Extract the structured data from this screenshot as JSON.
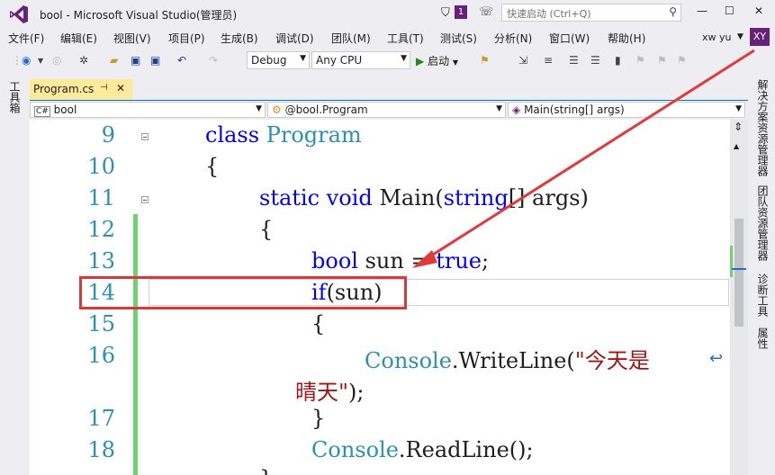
{
  "window": {
    "title": "bool - Microsoft Visual Studio(管理员)",
    "notification_count": "1",
    "quick_launch_placeholder": "快速启动 (Ctrl+Q)",
    "user_name": "xw yu",
    "user_initials": "XY"
  },
  "menu": [
    "文件(F)",
    "编辑(E)",
    "视图(V)",
    "项目(P)",
    "生成(B)",
    "调试(D)",
    "团队(M)",
    "工具(T)",
    "测试(S)",
    "分析(N)",
    "窗口(W)",
    "帮助(H)"
  ],
  "toolbar": {
    "config": "Debug",
    "platform": "Any CPU",
    "start_label": "启动"
  },
  "side_panels": {
    "left": "工具箱",
    "right": [
      "解决方案资源管理器",
      "团队资源管理器",
      "诊断工具",
      "属性"
    ]
  },
  "document_tab": {
    "label": "Program.cs",
    "pin": "⊣",
    "close": "✕"
  },
  "nav": {
    "project": "bool",
    "class": "@bool.Program",
    "member": "Main(string[] args)"
  },
  "code": {
    "line_numbers": [
      "9",
      "10",
      "11",
      "12",
      "13",
      "14",
      "15",
      "16",
      "17",
      "18"
    ],
    "l9_kw": "class",
    "l9_type": "Program",
    "l10": "{",
    "l11_static": "static",
    "l11_void": "void",
    "l11_main": "Main(",
    "l11_string": "string",
    "l11_rest": "[] args)",
    "l12": "{",
    "l13_bool": "bool",
    "l13_rest": "sun = ",
    "l13_true": "true",
    "l13_semi": ";",
    "l14_if": "if",
    "l14_rest": "(sun)",
    "l15": "{",
    "l16_console": "Console",
    "l16_rest": ".WriteLine(",
    "l16_str1": "\"今天是",
    "l16_str2": "晴天\"",
    "l16_end": ");",
    "l17": "}",
    "l18_console": "Console",
    "l18_rest": ".ReadLine();",
    "l19": "}"
  },
  "colors": {
    "accent": "#68217a",
    "keyword": "#0000ff",
    "type": "#2b91af",
    "string": "#a31515",
    "annotation": "#d93838",
    "tab_active": "#ffe99a"
  }
}
